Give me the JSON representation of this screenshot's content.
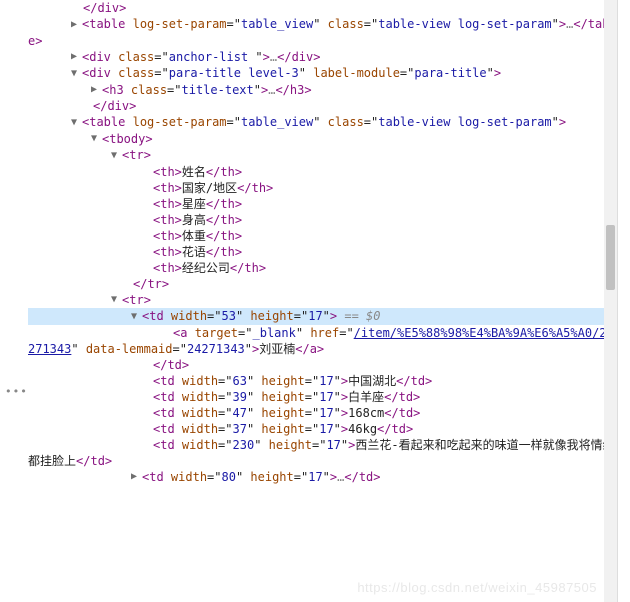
{
  "lines": [
    {
      "i": 55,
      "type": "close",
      "tag": "div"
    },
    {
      "i": 55,
      "type": "arrow",
      "arrow": "▶",
      "open": [
        [
          "table",
          [
            [
              "log-set-param",
              "table_view"
            ],
            [
              "class",
              "table-view log-set-param"
            ]
          ]
        ]
      ],
      "after_ell": true,
      "close_tags": [
        "table"
      ]
    },
    {
      "i": 55,
      "type": "arrow",
      "arrow": "▶",
      "open": [
        [
          "div",
          [
            [
              "class",
              "anchor-list "
            ]
          ]
        ]
      ],
      "after_ell": true,
      "close_tags": [
        "div"
      ]
    },
    {
      "i": 55,
      "type": "arrow",
      "arrow": "▼",
      "open": [
        [
          "div",
          [
            [
              "class",
              "para-title level-3"
            ],
            [
              "label-module",
              "para-title"
            ]
          ]
        ]
      ]
    },
    {
      "i": 75,
      "type": "arrow",
      "arrow": "▶",
      "open": [
        [
          "h3",
          [
            [
              "class",
              "title-text"
            ]
          ]
        ]
      ],
      "after_ell": true,
      "close_tags": [
        "h3"
      ]
    },
    {
      "i": 65,
      "type": "close",
      "tag": "div"
    },
    {
      "i": 55,
      "type": "arrow",
      "arrow": "▼",
      "open": [
        [
          "table",
          [
            [
              "log-set-param",
              "table_view"
            ],
            [
              "class",
              "table-view log-set-param"
            ]
          ]
        ]
      ]
    },
    {
      "i": 75,
      "type": "arrow",
      "arrow": "▼",
      "open": [
        [
          "tbody",
          []
        ]
      ]
    },
    {
      "i": 95,
      "type": "arrow",
      "arrow": "▼",
      "open": [
        [
          "tr",
          []
        ]
      ]
    },
    {
      "i": 125,
      "type": "th",
      "text": "姓名"
    },
    {
      "i": 125,
      "type": "th",
      "text": "国家/地区"
    },
    {
      "i": 125,
      "type": "th",
      "text": "星座"
    },
    {
      "i": 125,
      "type": "th",
      "text": "身高"
    },
    {
      "i": 125,
      "type": "th",
      "text": "体重"
    },
    {
      "i": 125,
      "type": "th",
      "text": "花语"
    },
    {
      "i": 125,
      "type": "th",
      "text": "经纪公司"
    },
    {
      "i": 105,
      "type": "close",
      "tag": "tr"
    },
    {
      "i": 95,
      "type": "arrow",
      "arrow": "▼",
      "open": [
        [
          "tr",
          []
        ]
      ]
    },
    {
      "i": 115,
      "type": "arrow",
      "arrow": "▼",
      "open": [
        [
          "td",
          [
            [
              "width",
              "53"
            ],
            [
              "height",
              "17"
            ]
          ]
        ]
      ],
      "selected": true,
      "sel_suffix": " == $0",
      "hl": true
    },
    {
      "i": 145,
      "type": "aopen",
      "target": "_blank",
      "href_disp": "/item/%E5%88%98%E4%BA%9A%E6%A5%A0/24271343",
      "data_lemmaid": "24271343",
      "atext": "刘亚楠"
    },
    {
      "i": 125,
      "type": "close",
      "tag": "td"
    },
    {
      "i": 125,
      "type": "td",
      "w": "63",
      "h": "17",
      "text": "中国湖北"
    },
    {
      "i": 125,
      "type": "td",
      "w": "39",
      "h": "17",
      "text": "白羊座"
    },
    {
      "i": 125,
      "type": "td",
      "w": "47",
      "h": "17",
      "text": "168cm"
    },
    {
      "i": 125,
      "type": "td",
      "w": "37",
      "h": "17",
      "text": "46kg"
    },
    {
      "i": 125,
      "type": "td",
      "w": "230",
      "h": "17",
      "text": "西兰花-看起来和吃起来的味道一样就像我将情绪都挂脸上"
    },
    {
      "i": 115,
      "type": "arrow",
      "arrow": "▶",
      "open": [
        [
          "td",
          [
            [
              "width",
              "80"
            ],
            [
              "height",
              "17"
            ]
          ]
        ]
      ],
      "after_ell": true,
      "close_tags": [
        "td"
      ]
    }
  ],
  "watermark": "https://blog.csdn.net/weixin_45987505",
  "dots": "•••"
}
